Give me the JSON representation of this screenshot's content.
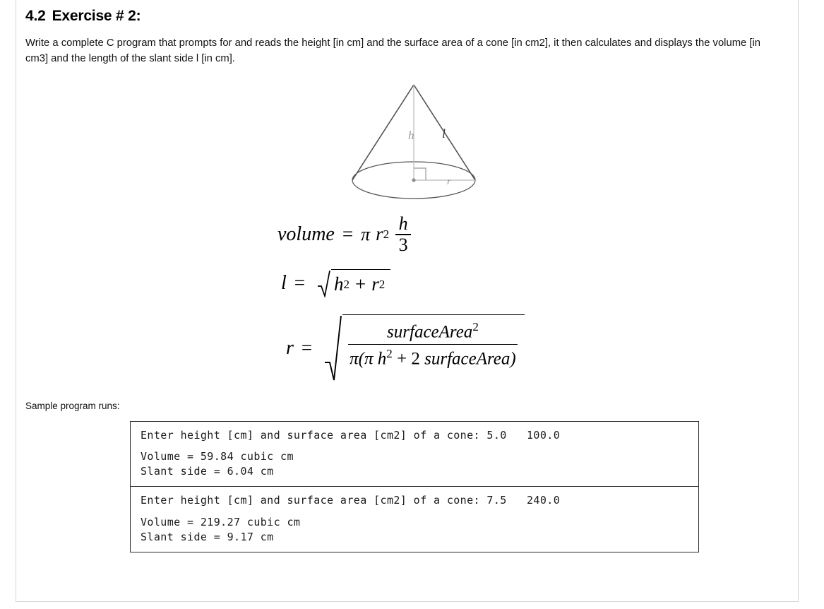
{
  "heading": {
    "number": "4.2",
    "text": "Exercise # 2:"
  },
  "body": {
    "paragraph": "Write a complete C program that prompts for and reads the height [in cm] and the surface area of a cone [in cm2], it then calculates and displays the volume [in cm3] and the length of the slant side l [in cm]."
  },
  "figure": {
    "alt": "cone-diagram",
    "labels": {
      "height": "h",
      "slant": "l",
      "radius": "r"
    }
  },
  "formulas": {
    "volume": {
      "lhs": "volume",
      "equals": "=",
      "pi": "π",
      "radius": "r",
      "radius_exp": "2",
      "frac_num": "h",
      "frac_den": "3"
    },
    "slant": {
      "lhs": "l",
      "equals": "=",
      "h": "h",
      "h_exp": "2",
      "plus": "+",
      "r": "r",
      "r_exp": "2"
    },
    "radius": {
      "lhs": "r",
      "equals": "=",
      "numerator": "surfaceArea",
      "numerator_exp": "2",
      "den_pi_outer": "π(",
      "den_pi_inner": "π",
      "den_h": "h",
      "den_h_exp": "2",
      "den_plus": "+",
      "den_two": "2",
      "den_surface": "surfaceArea",
      "den_close": ")"
    }
  },
  "sample": {
    "label": "Sample program runs:",
    "runs": [
      {
        "prompt": "Enter height [cm] and surface area [cm2] of a cone: 5.0   100.0",
        "volume": "Volume = 59.84 cubic cm",
        "slant": "Slant side = 6.04 cm"
      },
      {
        "prompt": "Enter height [cm] and surface area [cm2] of a cone: 7.5   240.0",
        "volume": "Volume = 219.27 cubic cm",
        "slant": "Slant side = 9.17 cm"
      }
    ]
  },
  "colors": {
    "page_rule": "#d4d4d4",
    "console_border": "#2b2b2b",
    "text": "#000000",
    "figure_stroke": "#555555",
    "figure_light": "#9a9a9a"
  }
}
